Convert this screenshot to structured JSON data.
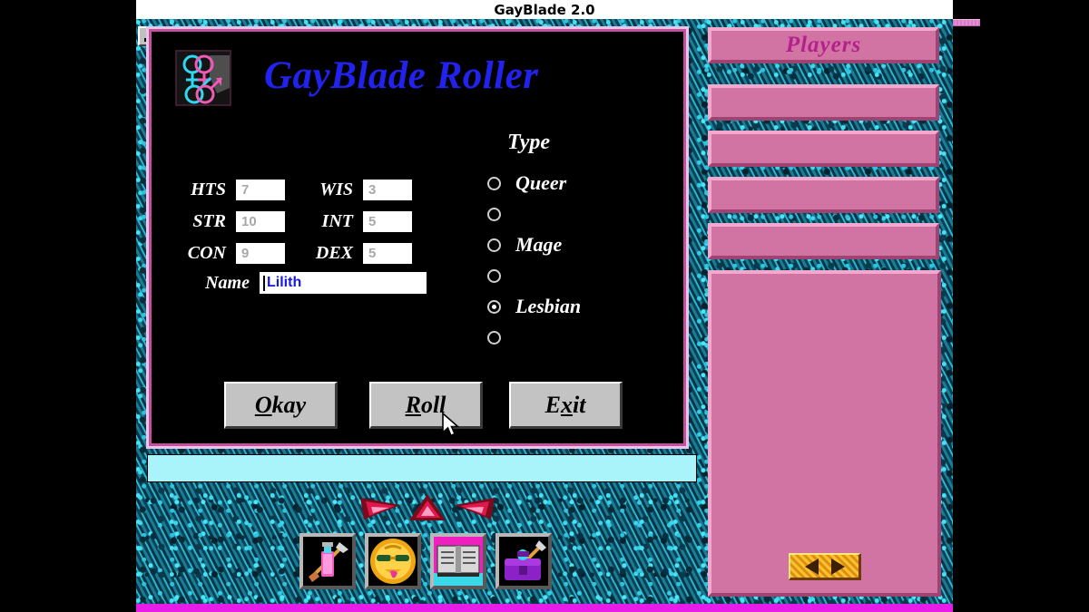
{
  "window": {
    "title": "GayBlade 2.0",
    "minimize_icon": "minimize-icon"
  },
  "dialog": {
    "title": "GayBlade Roller",
    "icon": "gender-symbols-icon",
    "stats": [
      {
        "label": "HTS",
        "value": "7"
      },
      {
        "label": "STR",
        "value": "10"
      },
      {
        "label": "CON",
        "value": "9"
      },
      {
        "label": "WIS",
        "value": "3"
      },
      {
        "label": "INT",
        "value": "5"
      },
      {
        "label": "DEX",
        "value": "5"
      }
    ],
    "name_field": {
      "label": "Name",
      "value": "Lilith"
    },
    "type_group": {
      "heading": "Type",
      "options": [
        {
          "label": "Queer",
          "selected": false
        },
        {
          "label": "",
          "selected": false
        },
        {
          "label": "Mage",
          "selected": false
        },
        {
          "label": "",
          "selected": false
        },
        {
          "label": "Lesbian",
          "selected": true
        },
        {
          "label": "",
          "selected": false
        }
      ]
    },
    "buttons": [
      {
        "name": "okay",
        "pre": "",
        "accel": "O",
        "post": "kay"
      },
      {
        "name": "roll",
        "pre": "",
        "accel": "R",
        "post": "oll"
      },
      {
        "name": "exit",
        "pre": "E",
        "accel": "x",
        "post": "it"
      }
    ]
  },
  "status_bar": {
    "message": ""
  },
  "hud": {
    "gems": [
      "gem-left-icon",
      "gem-center-icon",
      "gem-right-icon"
    ],
    "items": [
      {
        "name": "weapon-spray-item-icon"
      },
      {
        "name": "sun-face-amulet-item-icon"
      },
      {
        "name": "open-book-item-icon"
      },
      {
        "name": "purple-chest-item-icon"
      }
    ]
  },
  "players_panel": {
    "header": "Players",
    "slots": [
      "",
      "",
      "",
      ""
    ],
    "nav": {
      "prev_icon": "arrow-left-icon",
      "next_icon": "arrow-right-icon"
    }
  },
  "colors": {
    "pink_plate": "#d174a4",
    "pink_light": "#f3a9cd",
    "pink_dark": "#9e4372",
    "magenta_border": "#c2509f",
    "title_blue": "#2222ee",
    "status_cyan": "#a8f4fa",
    "gold": "#eda51e",
    "floor_magenta": "#e81ce8"
  }
}
